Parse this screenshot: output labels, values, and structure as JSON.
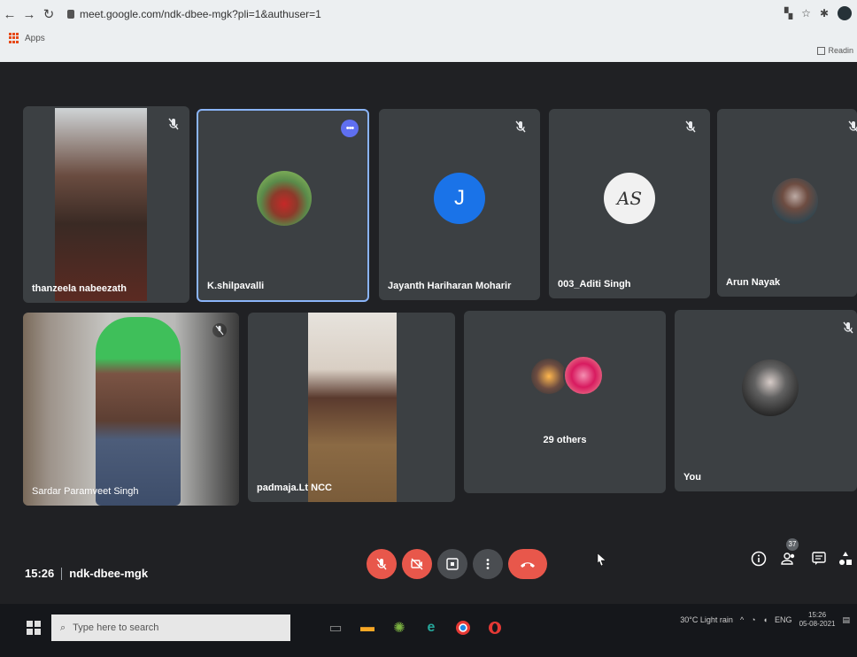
{
  "browser": {
    "url": "meet.google.com/ndk-dbee-mgk?pli=1&authuser=1",
    "bookmarks_label": "Apps",
    "reading_list_label": "Readin"
  },
  "participants_row1": [
    {
      "name": "thanzeela nabeezath",
      "muted": true,
      "type": "video"
    },
    {
      "name": "K.shilpavalli",
      "muted": false,
      "type": "photo",
      "active": true
    },
    {
      "name": "Jayanth Hariharan Moharir",
      "muted": true,
      "type": "letter",
      "letter": "J",
      "avatar_color": "#1a73e8"
    },
    {
      "name": "003_Aditi Singh",
      "muted": true,
      "type": "letter",
      "letter": "AS",
      "avatar_color": "#f1f1f1"
    },
    {
      "name": "Arun Nayak",
      "muted": true,
      "type": "photo"
    }
  ],
  "participants_row2": [
    {
      "name": "Sardar Paramveet Singh",
      "muted": true,
      "type": "video"
    },
    {
      "name": "padmaja.Lt NCC",
      "muted": false,
      "type": "video"
    },
    {
      "name": "29 others",
      "type": "others"
    },
    {
      "name": "You",
      "muted": true,
      "type": "photo"
    }
  ],
  "meeting": {
    "time": "15:26",
    "code": "ndk-dbee-mgk",
    "people_count": "37"
  },
  "taskbar": {
    "search_placeholder": "Type here to search",
    "weather": "30°C  Light rain",
    "language": "ENG",
    "clock_time": "15:26",
    "clock_date": "05-08-2021"
  },
  "colors": {
    "meet_bg": "#202124",
    "tile_bg": "#3c4043",
    "active_border": "#8ab4f8",
    "control_red": "#e8574b",
    "letter_avatar_blue": "#1a73e8"
  }
}
